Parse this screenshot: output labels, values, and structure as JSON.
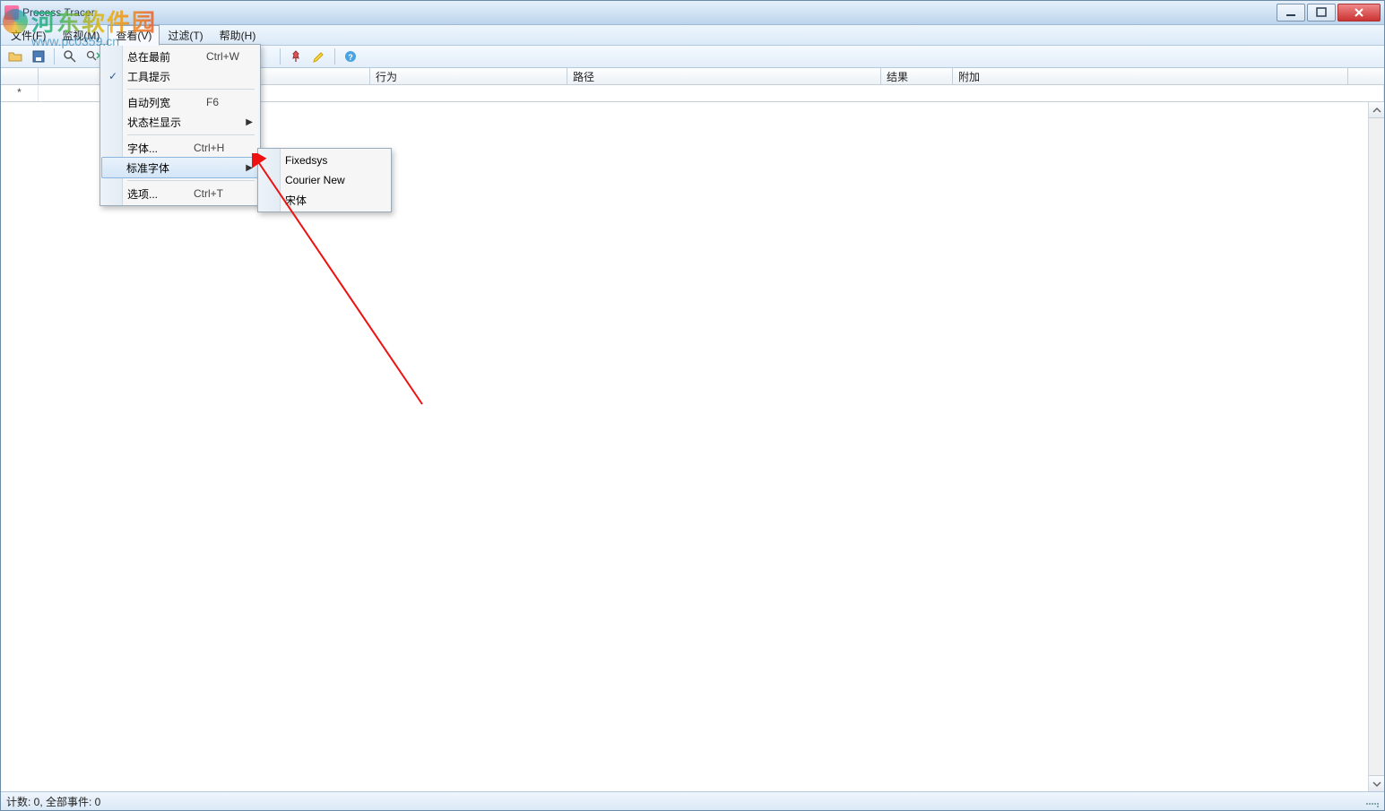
{
  "title": "Process Tracer",
  "watermark": {
    "line1": "河东软件园",
    "line2": "www.pc0359.cn"
  },
  "menubar": {
    "file": "文件(F)",
    "monitor": "监视(M)",
    "view": "查看(V)",
    "filter": "过滤(T)",
    "help": "帮助(H)"
  },
  "view_menu": {
    "always_on_top": {
      "label": "总在最前",
      "shortcut": "Ctrl+W"
    },
    "tooltips": {
      "label": "工具提示",
      "checked": true
    },
    "auto_col_width": {
      "label": "自动列宽",
      "shortcut": "F6"
    },
    "statusbar_display": {
      "label": "状态栏显示"
    },
    "font": {
      "label": "字体...",
      "shortcut": "Ctrl+H"
    },
    "standard_font": {
      "label": "标准字体"
    },
    "options": {
      "label": "选项...",
      "shortcut": "Ctrl+T"
    }
  },
  "font_submenu": {
    "fixedsys": "Fixedsys",
    "courier": "Courier New",
    "songti": "宋体"
  },
  "columns": {
    "c0": "",
    "c1": "行为",
    "c2": "路径",
    "c3": "结果",
    "c4": "附加"
  },
  "filter_row": {
    "star": "*"
  },
  "statusbar": {
    "text": "计数: 0,  全部事件: 0"
  }
}
